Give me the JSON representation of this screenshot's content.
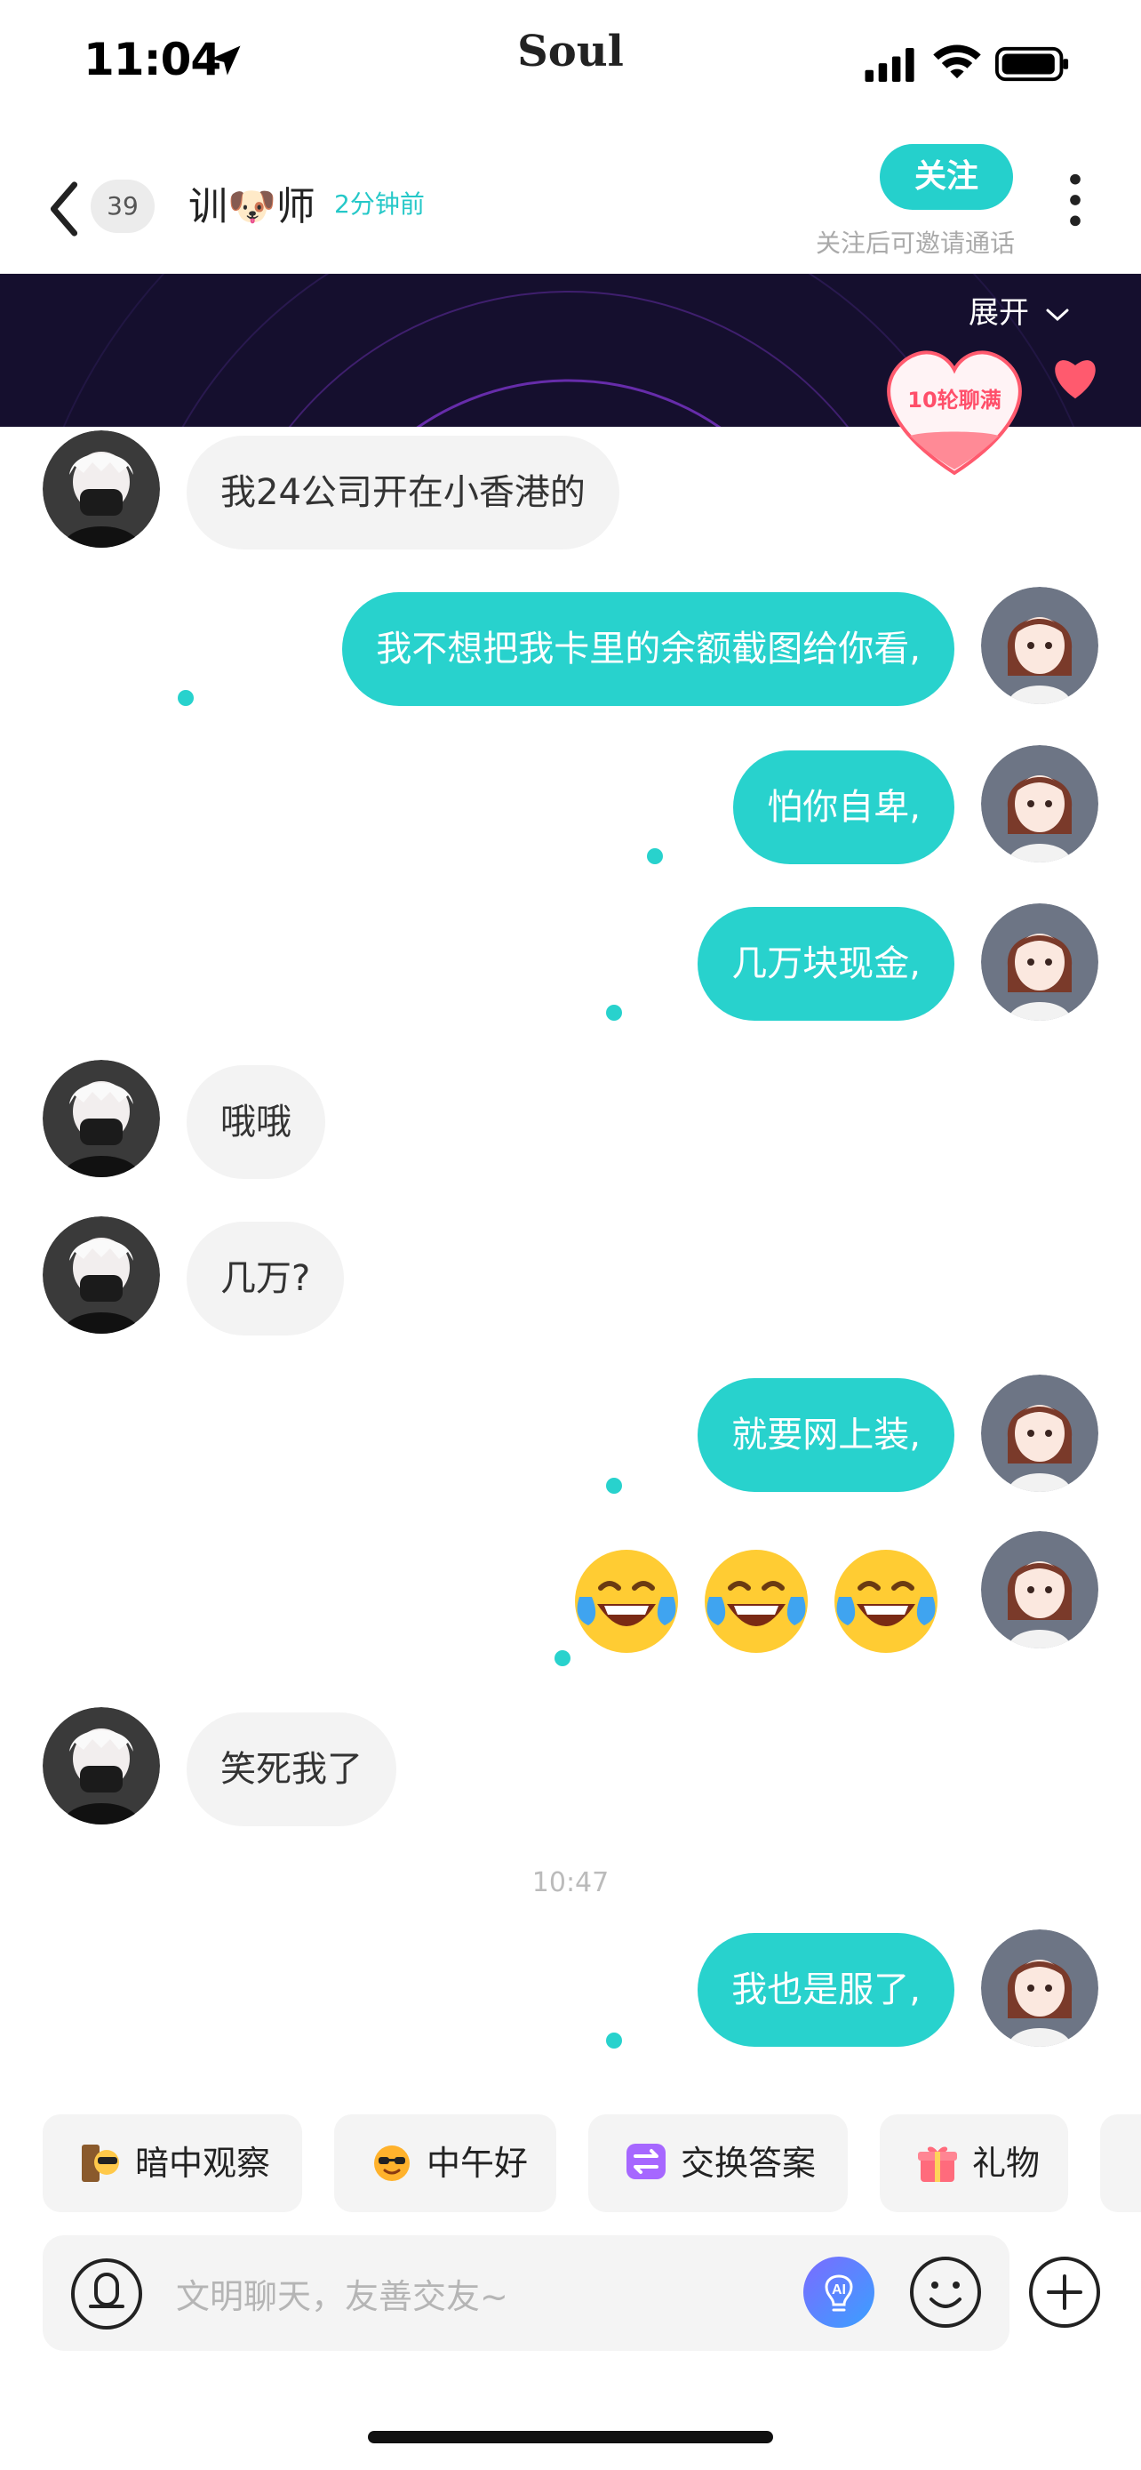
{
  "status_bar": {
    "time": "11:04",
    "app_name": "Soul"
  },
  "header": {
    "unread_count": "39",
    "name": "训🐶师",
    "last_active": "2分钟前",
    "follow_label": "关注",
    "follow_hint": "关注后可邀请通话"
  },
  "banner": {
    "expand_label": "展开",
    "heart_badge": "10轮聊满"
  },
  "messages": [
    {
      "side": "in",
      "text": "我24公司开在小香港的"
    },
    {
      "side": "out",
      "text": "我不想把我卡里的余额截图给你看,"
    },
    {
      "side": "out",
      "text": "怕你自卑,"
    },
    {
      "side": "out",
      "text": "几万块现金,"
    },
    {
      "side": "in",
      "text": "哦哦"
    },
    {
      "side": "in",
      "text": "几万?"
    },
    {
      "side": "out",
      "text": "就要网上装,"
    },
    {
      "side": "out",
      "emoji": "face-with-tears-of-joy x3"
    },
    {
      "side": "in",
      "text": "笑死我了"
    },
    {
      "side": "out",
      "text": "我也是服了,"
    }
  ],
  "timestamp": "10:47",
  "chips": [
    {
      "label": "暗中观察",
      "icon": "peek-icon"
    },
    {
      "label": "中午好",
      "icon": "sun-sunglasses-icon"
    },
    {
      "label": "交换答案",
      "icon": "exchange-icon"
    },
    {
      "label": "礼物",
      "icon": "gift-icon"
    }
  ],
  "input": {
    "placeholder": "文明聊天，友善交友~"
  },
  "colors": {
    "accent": "#28d2cd",
    "incoming_bubble": "#f3f3f3",
    "banner_bg": "#150f2e"
  }
}
